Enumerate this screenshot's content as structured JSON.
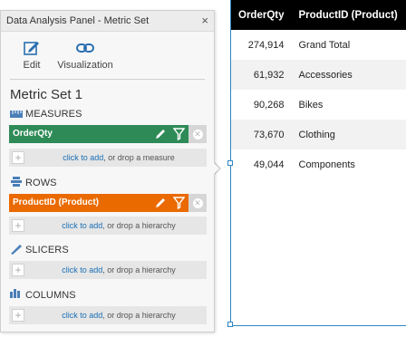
{
  "panel": {
    "title": "Data Analysis Panel - Metric Set",
    "close_glyph": "×",
    "toolbar": {
      "edit_label": "Edit",
      "edit_icon": "edit-icon",
      "visualization_label": "Visualization",
      "visualization_icon": "link-icon"
    },
    "metric_set_title": "Metric Set 1",
    "sections": {
      "measures": {
        "label": "MEASURES",
        "icon": "ruler-icon",
        "item": "OrderQty",
        "item_color": "#2e8b57",
        "drop_link": "click to add",
        "drop_rest": ", or drop a measure"
      },
      "rows": {
        "label": "ROWS",
        "icon": "stack-icon",
        "item": "ProductID (Product)",
        "item_color": "#ea6a00",
        "drop_link": "click to add",
        "drop_rest": ", or drop a hierarchy"
      },
      "slicers": {
        "label": "SLICERS",
        "icon": "slicer-icon",
        "drop_link": "click to add",
        "drop_rest": ", or drop a hierarchy"
      },
      "columns": {
        "label": "COLUMNS",
        "icon": "columns-icon",
        "drop_link": "click to add",
        "drop_rest": ", or drop a hierarchy"
      }
    }
  },
  "table": {
    "headers": [
      "OrderQty",
      "ProductID (Product)"
    ],
    "rows": [
      {
        "qty": "274,914",
        "product": "Grand Total"
      },
      {
        "qty": "61,932",
        "product": "Accessories"
      },
      {
        "qty": "90,268",
        "product": "Bikes"
      },
      {
        "qty": "73,670",
        "product": "Clothing"
      },
      {
        "qty": "49,044",
        "product": "Components"
      }
    ]
  },
  "colors": {
    "accent_blue": "#2e86c1",
    "link_blue": "#1a6fb5",
    "measure_green": "#2e8b57",
    "row_orange": "#ea6a00",
    "header_black": "#000000"
  }
}
